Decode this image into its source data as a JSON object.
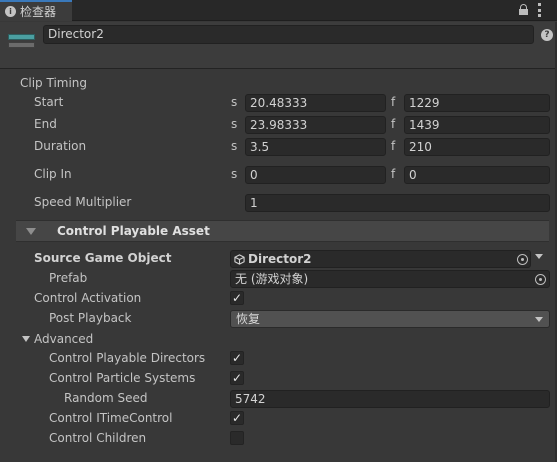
{
  "tab": {
    "title": "检查器"
  },
  "header": {
    "object_name": "Director2"
  },
  "clip_timing": {
    "title": "Clip Timing",
    "start": {
      "label": "Start",
      "s_prefix": "s",
      "s_value": "20.48333",
      "f_prefix": "f",
      "f_value": "1229"
    },
    "end": {
      "label": "End",
      "s_prefix": "s",
      "s_value": "23.98333",
      "f_prefix": "f",
      "f_value": "1439"
    },
    "duration": {
      "label": "Duration",
      "s_prefix": "s",
      "s_value": "3.5",
      "f_prefix": "f",
      "f_value": "210"
    },
    "clip_in": {
      "label": "Clip In",
      "s_prefix": "s",
      "s_value": "0",
      "f_prefix": "f",
      "f_value": "0"
    },
    "speed_multiplier": {
      "label": "Speed Multiplier",
      "value": "1"
    }
  },
  "control_playable_asset": {
    "title": "Control Playable Asset",
    "source_game_object": {
      "label": "Source Game Object",
      "value": "Director2"
    },
    "prefab": {
      "label": "Prefab",
      "value": "无 (游戏对象)"
    },
    "control_activation": {
      "label": "Control Activation",
      "checked": true
    },
    "post_playback": {
      "label": "Post Playback",
      "value": "恢复"
    },
    "advanced": {
      "label": "Advanced",
      "control_playable_directors": {
        "label": "Control Playable Directors",
        "checked": true
      },
      "control_particle_systems": {
        "label": "Control Particle Systems",
        "checked": true
      },
      "random_seed": {
        "label": "Random Seed",
        "value": "5742"
      },
      "control_itimecontrol": {
        "label": "Control ITimeControl",
        "checked": true
      },
      "control_children": {
        "label": "Control Children",
        "checked": false
      }
    }
  },
  "colors": {
    "background": "#383838",
    "field": "#2a2a2a",
    "accent": "#3a79bb",
    "icon_teal": "#4b9fa1"
  },
  "icons": {
    "check": "✓",
    "help": "?",
    "info": "i"
  }
}
